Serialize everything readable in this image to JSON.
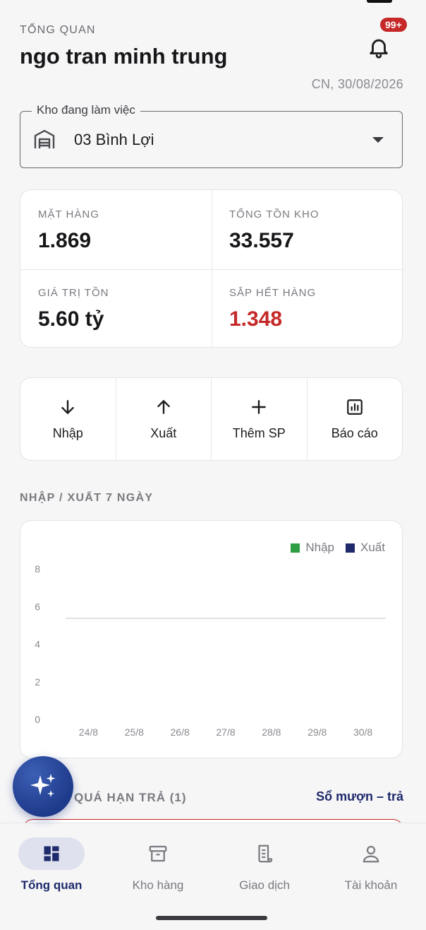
{
  "header": {
    "overline": "TỔNG QUAN",
    "user_name": "ngo tran minh trung",
    "notification_badge": "99+",
    "date": "CN, 30/08/2026"
  },
  "warehouse": {
    "label": "Kho đang làm việc",
    "value": "03 Bình Lợi",
    "icon": "warehouse-icon"
  },
  "stats": {
    "items_label": "MẶT HÀNG",
    "items_value": "1.869",
    "stock_label": "TỔNG TỒN KHO",
    "stock_value": "33.557",
    "value_label": "GIÁ TRỊ TỒN",
    "value_value": "5.60 tỷ",
    "low_label": "SẮP HẾT HÀNG",
    "low_value": "1.348",
    "low_color": "#c62828"
  },
  "actions": [
    {
      "label": "Nhập",
      "icon": "arrow-down-icon"
    },
    {
      "label": "Xuất",
      "icon": "arrow-up-icon"
    },
    {
      "label": "Thêm SP",
      "icon": "plus-icon"
    },
    {
      "label": "Báo cáo",
      "icon": "bar-chart-icon"
    }
  ],
  "chart_section_title": "NHẬP / XUẤT 7 NGÀY",
  "chart_data": {
    "type": "bar",
    "categories": [
      "24/8",
      "25/8",
      "26/8",
      "27/8",
      "28/8",
      "29/8",
      "30/8"
    ],
    "series": [
      {
        "name": "Nhập",
        "color": "#2e9e44",
        "values": [
          0,
          0,
          0,
          0,
          0,
          0,
          0
        ]
      },
      {
        "name": "Xuất",
        "color": "#1e2a6b",
        "values": [
          0,
          0,
          0,
          0,
          0,
          0,
          0
        ]
      }
    ],
    "yticks": [
      0,
      2,
      4,
      6,
      8
    ],
    "ylim": [
      0,
      8
    ],
    "reference_line": 5,
    "legend": "top-right"
  },
  "overdue": {
    "title": "QUÁ HẠN TRẢ (1)",
    "link": "Sổ mượn – trả"
  },
  "nav": [
    {
      "label": "Tổng quan",
      "icon": "dashboard-icon",
      "active": true
    },
    {
      "label": "Kho hàng",
      "icon": "archive-icon",
      "active": false
    },
    {
      "label": "Giao dịch",
      "icon": "receipt-icon",
      "active": false
    },
    {
      "label": "Tài khoản",
      "icon": "person-icon",
      "active": false
    }
  ],
  "colors": {
    "primary": "#1e2a6b",
    "alert": "#c62828",
    "fab": "#1e3a8a"
  }
}
